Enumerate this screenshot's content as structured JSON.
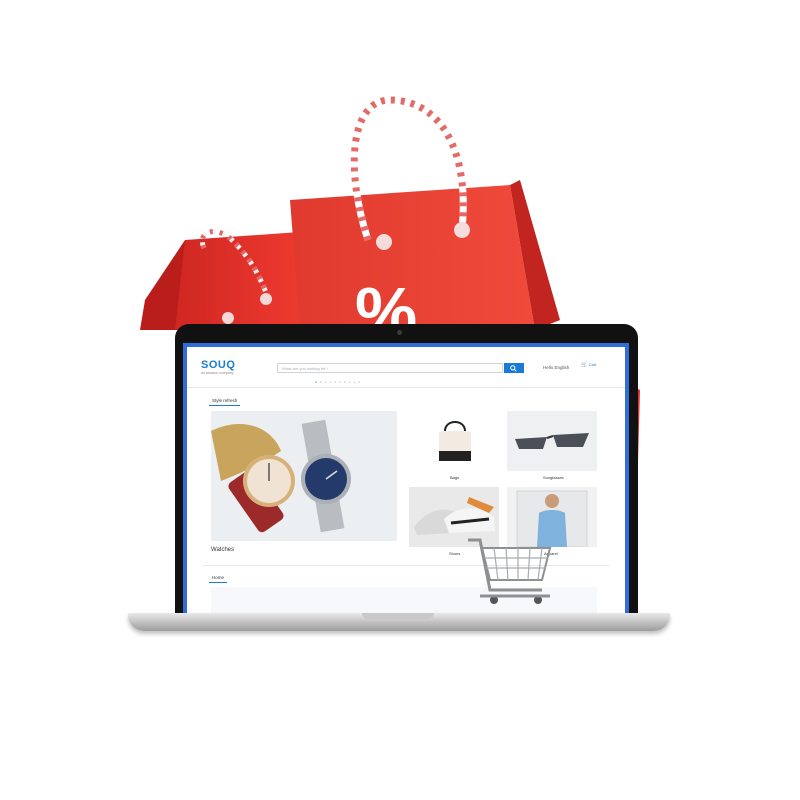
{
  "site": {
    "logo": "SOUQ",
    "logo_sub": "an amazon company",
    "search_placeholder": "What are you looking for?",
    "language": "Hello English",
    "cart_label": "Cart"
  },
  "sections": {
    "featured_tab": "Style refresh",
    "second_tab": "Home"
  },
  "tiles": [
    {
      "label": "Watches"
    },
    {
      "label": "Bags"
    },
    {
      "label": "Sunglasses"
    },
    {
      "label": "Shoes"
    },
    {
      "label": "Apparel"
    }
  ],
  "colors": {
    "bag_red": "#e5312c",
    "brand_blue": "#1a7bd6"
  },
  "icons": [
    "search-icon",
    "cart-icon",
    "shopping-bag-icon",
    "percent-icon",
    "shopping-cart-icon"
  ]
}
